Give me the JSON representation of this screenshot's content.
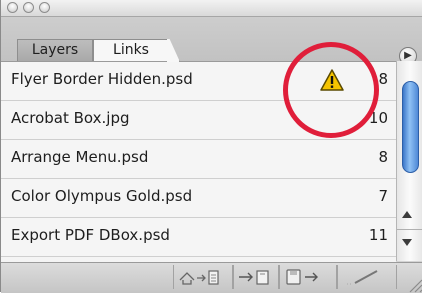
{
  "window": {
    "title_buttons": [
      "close",
      "minimize",
      "zoom"
    ]
  },
  "tabs": [
    {
      "label": "Layers",
      "active": false
    },
    {
      "label": "Links",
      "active": true
    }
  ],
  "panel_menu_icon": "triangle-right-icon",
  "links": [
    {
      "name": "Flyer Border Hidden.psd",
      "page": "8",
      "status": "warning"
    },
    {
      "name": "Acrobat Box.jpg",
      "page": "10",
      "status": "ok"
    },
    {
      "name": "Arrange Menu.psd",
      "page": "8",
      "status": "ok"
    },
    {
      "name": "Color Olympus Gold.psd",
      "page": "7",
      "status": "ok"
    },
    {
      "name": "Export PDF DBox.psd",
      "page": "11",
      "status": "ok"
    }
  ],
  "footer_buttons": [
    "relink-icon",
    "go-to-link-icon",
    "update-link-icon",
    "edit-original-icon"
  ],
  "colors": {
    "highlight_circle": "#e01e3a",
    "warning_yellow": "#f5c400",
    "scroll_thumb": "#5b95dd"
  }
}
